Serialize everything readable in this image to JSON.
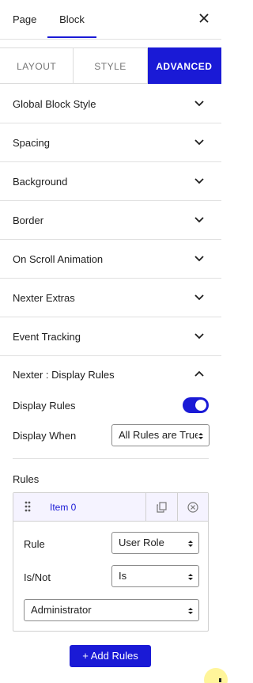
{
  "header": {
    "tabs": [
      "Page",
      "Block"
    ],
    "active_tab": "Block",
    "close_icon": "close-icon"
  },
  "mode_tabs": {
    "items": [
      "LAYOUT",
      "STYLE",
      "ADVANCED"
    ],
    "active": "ADVANCED",
    "accent_color": "#1a1ad6"
  },
  "panels": [
    {
      "label": "Global Block Style"
    },
    {
      "label": "Spacing"
    },
    {
      "label": "Background"
    },
    {
      "label": "Border"
    },
    {
      "label": "On Scroll Animation"
    },
    {
      "label": "Nexter Extras"
    },
    {
      "label": "Event Tracking"
    }
  ],
  "display_rules": {
    "title": "Nexter : Display Rules",
    "toggle_label": "Display Rules",
    "toggle_on": true,
    "when_label": "Display When",
    "when_value": "All Rules are True",
    "rules_label": "Rules",
    "rule_item": {
      "name": "Item 0",
      "rule_label": "Rule",
      "rule_value": "User Role",
      "isnot_label": "Is/Not",
      "isnot_value": "Is",
      "role_value": "Administrator"
    },
    "add_button": "+ Add Rules"
  }
}
